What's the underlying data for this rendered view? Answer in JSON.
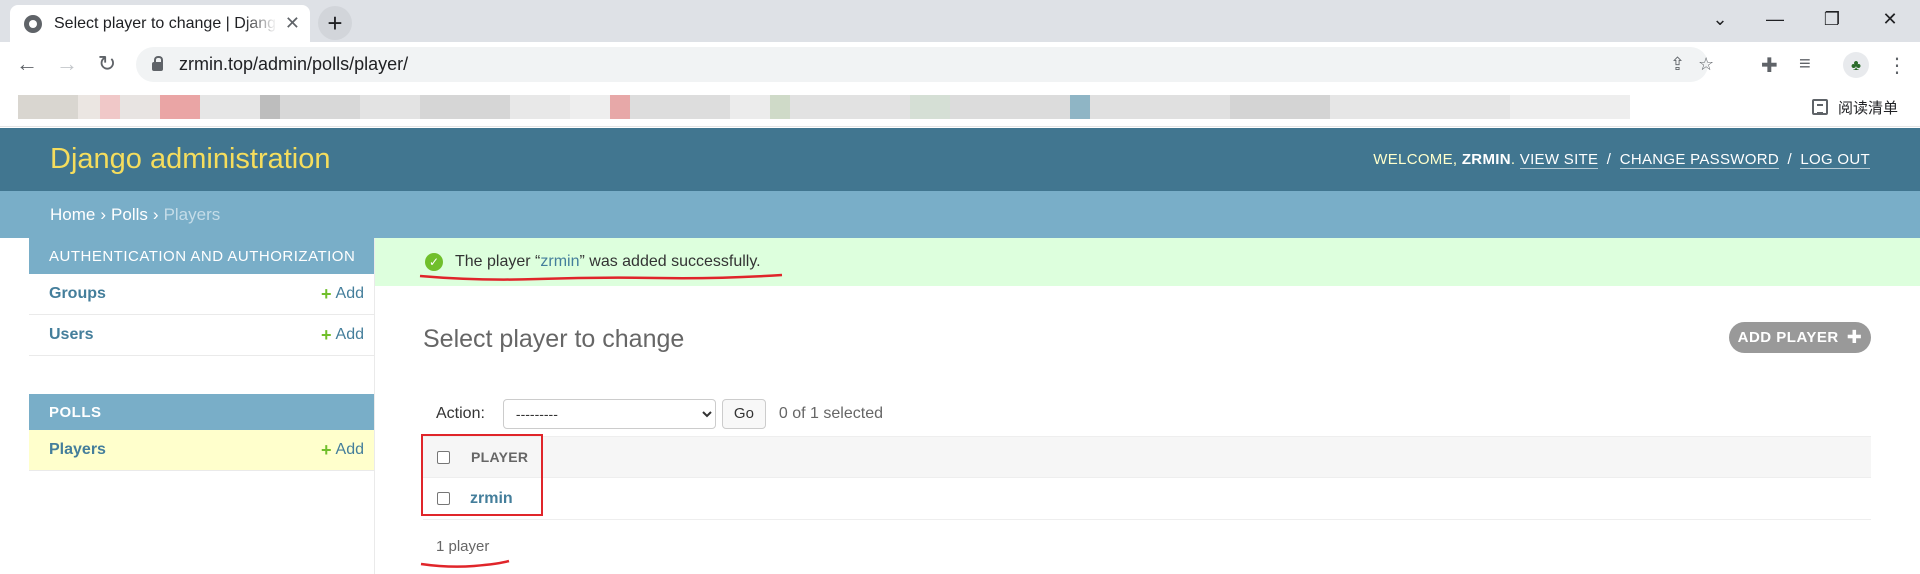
{
  "browser": {
    "tab_title": "Select player to change | Django site admin",
    "new_tab_symbol": "+",
    "window_controls": {
      "collapse": "⌄",
      "minimize": "—",
      "restore": "❐",
      "close": "✕"
    },
    "url": "zrmin.top/admin/polls/player/",
    "reading_list_label": "阅读清单"
  },
  "admin": {
    "branding": "Django administration",
    "user_tools": {
      "welcome": "WELCOME,",
      "username": "ZRMIN",
      "view_site": "VIEW SITE",
      "change_password": "CHANGE PASSWORD",
      "log_out": "LOG OUT",
      "separator": "/"
    },
    "breadcrumbs": {
      "home": "Home",
      "polls": "Polls",
      "current": "Players",
      "separator": "›"
    },
    "sidebar": {
      "auth_caption": "AUTHENTICATION AND AUTHORIZATION",
      "groups": "Groups",
      "users": "Users",
      "polls_caption": "POLLS",
      "players": "Players",
      "add_label": "Add"
    },
    "message": {
      "prefix": "The player “",
      "link": "zrmin",
      "suffix": "” was added successfully."
    },
    "page_title": "Select player to change",
    "add_button": "ADD PLAYER",
    "actions": {
      "label": "Action:",
      "selected_option": "---------",
      "go": "Go",
      "selected_count": "0 of 1 selected"
    },
    "table": {
      "header": "PLAYER",
      "rows": [
        "zrmin"
      ]
    },
    "paginator": "1 player"
  },
  "colors": {
    "header_bg": "#417690",
    "breadcrumb_bg": "#79aec8",
    "branding": "#f5dd5d",
    "link": "#447e9b",
    "success_bg": "#ddffdd",
    "add_green": "#70bf2b",
    "annotation_red": "#e0252a"
  }
}
